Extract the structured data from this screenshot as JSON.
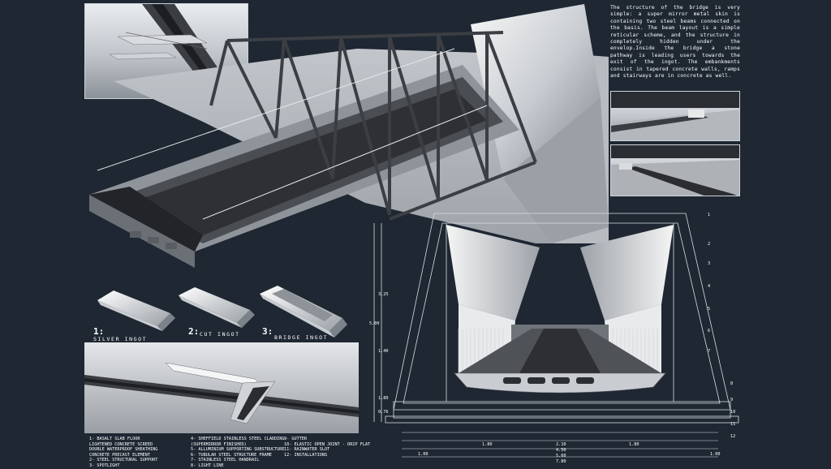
{
  "description": "The structure of the bridge is very simple: a super mirror metal skin is containing two steel beams connected on the basis. The beam layout is a simple reticular scheme, and the structure in completely hidden under the envelop.Inside the bridge a stone pathway is leading users towards the exit of the ingot. The embankments consist in tapered concrete walls, ramps and stairways are in concrete as well.",
  "ingots": [
    {
      "num": "1:",
      "label": "SILVER INGOT"
    },
    {
      "num": "2:",
      "label": "CUT INGOT"
    },
    {
      "num": "3:",
      "label": "BRIDGE INGOT"
    }
  ],
  "legend": {
    "col1": [
      "1- BASALT SLAB FLOOR",
      "LIGHTENED CONCRETE SCREED",
      "DOUBLE WATERPROOF SHEATHING",
      "CONCRETE PRECAST ELEMENT",
      "2- STEEL STRUCTURAL SUPPORT",
      "3- SPOTLIGHT"
    ],
    "col2": [
      "4- SHEFFIELD STAINLESS STEEL CLADDING",
      "(SUPERMIRROR FINISHED)",
      "5- ALLUMINIUM SUPPORTING SUBSTRUCTURE",
      "6- TUBULAR STEEL STRUCTURE FRAME",
      "7- STAINLESS STEEL HANDRAIL",
      "8- LIGHT LINE"
    ],
    "col3": [
      "9- GUTTER",
      "10- ELASTIC OPEN JOINT - DRIP FLAT",
      "11- RAINWATER SLOT",
      "12- INSTALLATIONS"
    ]
  },
  "dimensions": {
    "bottom": [
      "1.00",
      "1.80",
      "2.10",
      "1.80",
      "4.50",
      "5.60",
      "7.80",
      "1.00"
    ],
    "left": [
      "3.25",
      "5.00",
      "1.40",
      "1.80",
      "0.76"
    ]
  },
  "section_numbers": [
    "1",
    "2",
    "3",
    "4",
    "5",
    "6",
    "7",
    "8",
    "9",
    "10",
    "11",
    "12"
  ],
  "colors": {
    "background": "#1f2733",
    "drawing_line": "#d9dde2",
    "mirror_light": "#f2f2f2",
    "mirror_dark": "#8a8f96"
  }
}
